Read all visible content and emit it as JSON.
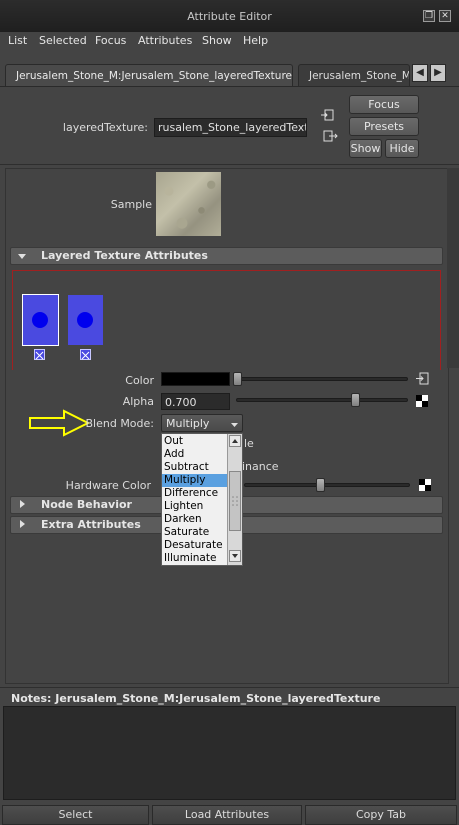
{
  "window": {
    "title": "Attribute Editor"
  },
  "menu": [
    "List",
    "Selected",
    "Focus",
    "Attributes",
    "Show",
    "Help"
  ],
  "tabs": [
    {
      "label": "Jerusalem_Stone_M:Jerusalem_Stone_layeredTexture",
      "active": true
    },
    {
      "label": "Jerusalem_Stone_M:Jerusalem_Stone_M",
      "active": false
    }
  ],
  "node": {
    "type_label": "layeredTexture:",
    "name_value": "rusalem_Stone_layeredTexture"
  },
  "buttons": {
    "focus": "Focus",
    "presets": "Presets",
    "show": "Show",
    "hide": "Hide"
  },
  "sample_label": "Sample",
  "sections": {
    "layered_texture": "Layered Texture Attributes",
    "node_behavior": "Node Behavior",
    "extra_attributes": "Extra Attributes"
  },
  "attributes": {
    "color_label": "Color",
    "color_value": "#000000",
    "alpha_label": "Alpha",
    "alpha_value": "0.700",
    "blend_mode_label": "Blend Mode:",
    "blend_mode_value": "Multiply",
    "hardware_color_label": "Hardware Color",
    "partial_visible": {
      "visible_suffix": "le",
      "alpha_is_luminance_suffix": "inance"
    }
  },
  "blend_modes": [
    "Out",
    "Add",
    "Subtract",
    "Multiply",
    "Difference",
    "Lighten",
    "Darken",
    "Saturate",
    "Desaturate",
    "Illuminate"
  ],
  "blend_mode_selected_index": 3,
  "notes": {
    "label": "Notes:  Jerusalem_Stone_M:Jerusalem_Stone_layeredTexture",
    "text": ""
  },
  "bottom_buttons": {
    "select": "Select",
    "load": "Load Attributes",
    "copy": "Copy Tab"
  },
  "colors": {
    "layer_swatch": "#4a4ae0",
    "layer_dot": "#0000ee",
    "arrow_annotation": "#ffff00",
    "accent_red": "#a02020"
  },
  "sliders": {
    "alpha_fraction": 0.7
  }
}
